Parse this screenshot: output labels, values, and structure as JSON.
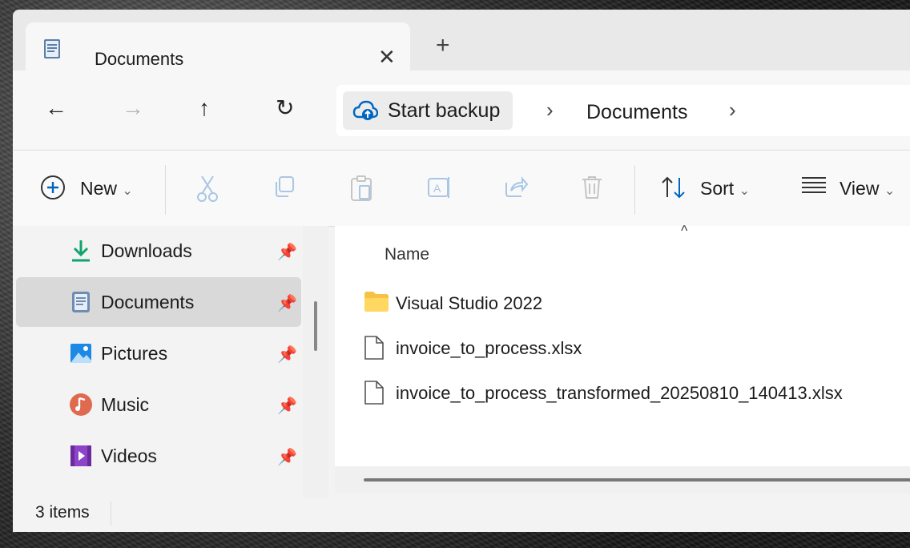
{
  "tabs": [
    {
      "label": "Documents",
      "active": true
    }
  ],
  "tab_new_symbol": "+",
  "tab_close_symbol": "✕",
  "nav": {
    "back_icon": "←",
    "forward_icon": "→",
    "up_icon": "↑",
    "refresh_icon": "↻"
  },
  "address": {
    "backup_label": "Start backup",
    "separator": "›",
    "current": "Documents"
  },
  "commands": {
    "new_label": "New",
    "sort_label": "Sort",
    "view_label": "View",
    "dropdown_caret": "⌄"
  },
  "sidebar": {
    "items": [
      {
        "label": "Downloads",
        "icon": "download-icon",
        "pinned": true
      },
      {
        "label": "Documents",
        "icon": "documents-icon",
        "pinned": true,
        "selected": true
      },
      {
        "label": "Pictures",
        "icon": "pictures-icon",
        "pinned": true
      },
      {
        "label": "Music",
        "icon": "music-icon",
        "pinned": true
      },
      {
        "label": "Videos",
        "icon": "videos-icon",
        "pinned": true
      }
    ]
  },
  "content": {
    "column_name": "Name",
    "sort_caret": "^",
    "files": [
      {
        "name": "Visual Studio 2022",
        "type": "folder"
      },
      {
        "name": "invoice_to_process.xlsx",
        "type": "file"
      },
      {
        "name": "invoice_to_process_transformed_20250810_140413.xlsx",
        "type": "file"
      }
    ]
  },
  "status": {
    "item_count": "3 items"
  },
  "colors": {
    "accent": "#0067c0",
    "folder": "#f6c244",
    "selected_bg": "#d9d9d9",
    "download_green": "#12a36b"
  }
}
